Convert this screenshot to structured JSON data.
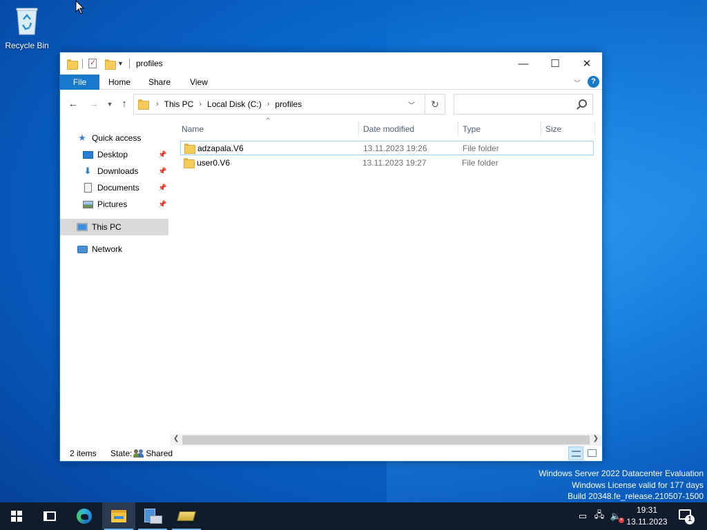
{
  "desktop": {
    "recycle_bin_label": "Recycle Bin"
  },
  "window": {
    "title": "profiles",
    "controls": {
      "minimize": "—",
      "maximize": "☐",
      "close": "✕"
    }
  },
  "ribbon": {
    "tabs": [
      {
        "label": "File"
      },
      {
        "label": "Home"
      },
      {
        "label": "Share"
      },
      {
        "label": "View"
      }
    ],
    "help_label": "?"
  },
  "address_bar": {
    "breadcrumbs": [
      "This PC",
      "Local Disk (C:)",
      "profiles"
    ],
    "search_placeholder": ""
  },
  "nav_pane": {
    "items": [
      {
        "label": "Quick access",
        "icon": "star-icon"
      },
      {
        "label": "Desktop",
        "icon": "desktop-icon",
        "pinned": true
      },
      {
        "label": "Downloads",
        "icon": "download-arrow-icon",
        "pinned": true
      },
      {
        "label": "Documents",
        "icon": "document-icon",
        "pinned": true
      },
      {
        "label": "Pictures",
        "icon": "pictures-icon",
        "pinned": true
      },
      {
        "label": "This PC",
        "icon": "computer-icon",
        "selected": true
      },
      {
        "label": "Network",
        "icon": "network-icon"
      }
    ]
  },
  "file_list": {
    "columns": [
      "Name",
      "Date modified",
      "Type",
      "Size"
    ],
    "rows": [
      {
        "name": "adzapala.V6",
        "date": "13.11.2023 19:26",
        "type": "File folder",
        "size": "",
        "selected": true
      },
      {
        "name": "user0.V6",
        "date": "13.11.2023 19:27",
        "type": "File folder",
        "size": "",
        "selected": false
      }
    ]
  },
  "status_bar": {
    "item_count": "2 items",
    "state_label": "State:",
    "state_value": "Shared"
  },
  "watermark": {
    "line1": "Windows Server 2022 Datacenter Evaluation",
    "line2": "Windows License valid for 177 days",
    "line3": "Build 20348.fe_release.210507-1500"
  },
  "taskbar": {
    "apps": [
      "start-icon",
      "task-view-icon",
      "edge-icon",
      "file-explorer-icon",
      "server-manager-icon",
      "drive-icon"
    ],
    "clock_time": "19:31",
    "clock_date": "13.11.2023",
    "notification_count": "1"
  },
  "colors": {
    "accent": "#1979ca",
    "taskbar": "#101c2c",
    "selection": "#cce8ff"
  }
}
